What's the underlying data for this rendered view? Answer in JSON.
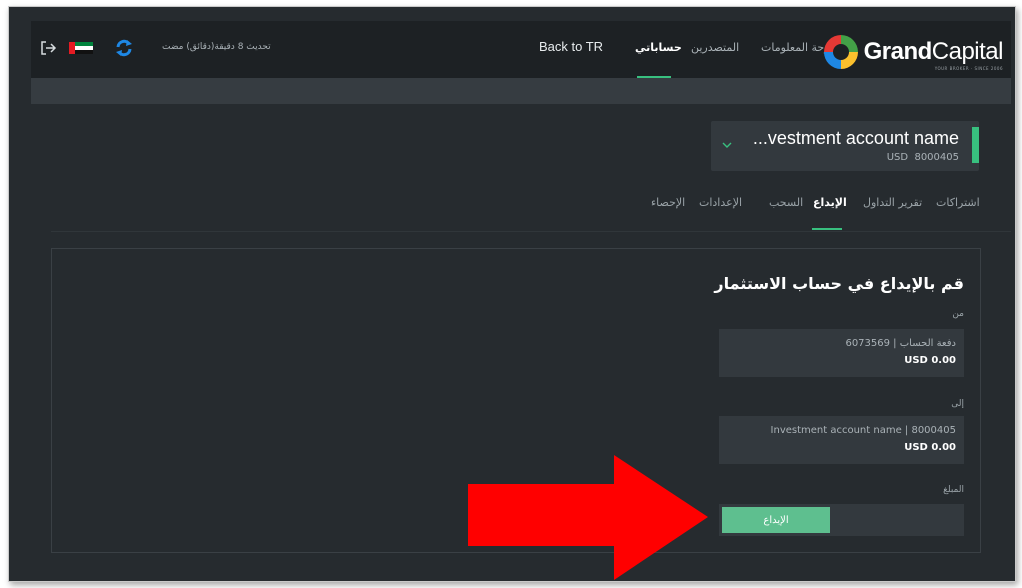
{
  "brand": {
    "name_bold": "Grand",
    "name_light": "Capital",
    "tagline": "YOUR BROKER · SINCE 2006"
  },
  "nav": {
    "items": [
      "لوحة المعلومات",
      "المتصدرين",
      "حساباتي"
    ],
    "active": "حساباتي",
    "back_link": "Back to TR"
  },
  "toolbar": {
    "updated_text": "تحديث 8 دقيقة(دقائق) مضت"
  },
  "account": {
    "name": "...vestment account name",
    "currency": "USD",
    "number": "8000405"
  },
  "tabs": [
    "اشتراكات",
    "تقرير التداول",
    "الإيداع",
    "السحب",
    "الإعدادات",
    "الإحصاء"
  ],
  "active_tab": "الإيداع",
  "form": {
    "heading": "قم بالإيداع في حساب الاستثمار",
    "from_label": "من",
    "from_account": "دفعة الحساب | 6073569",
    "from_balance": "USD 0.00",
    "to_label": "إلى",
    "to_account": "Investment account name | 8000405",
    "to_balance": "USD 0.00",
    "amount_label": "المبلغ",
    "deposit_button": "الإيداع"
  },
  "colors": {
    "accent": "#38c07f",
    "button": "#5ebf8f",
    "background": "#262b2f",
    "topbar": "#1d2124",
    "arrow": "#ff0000"
  }
}
